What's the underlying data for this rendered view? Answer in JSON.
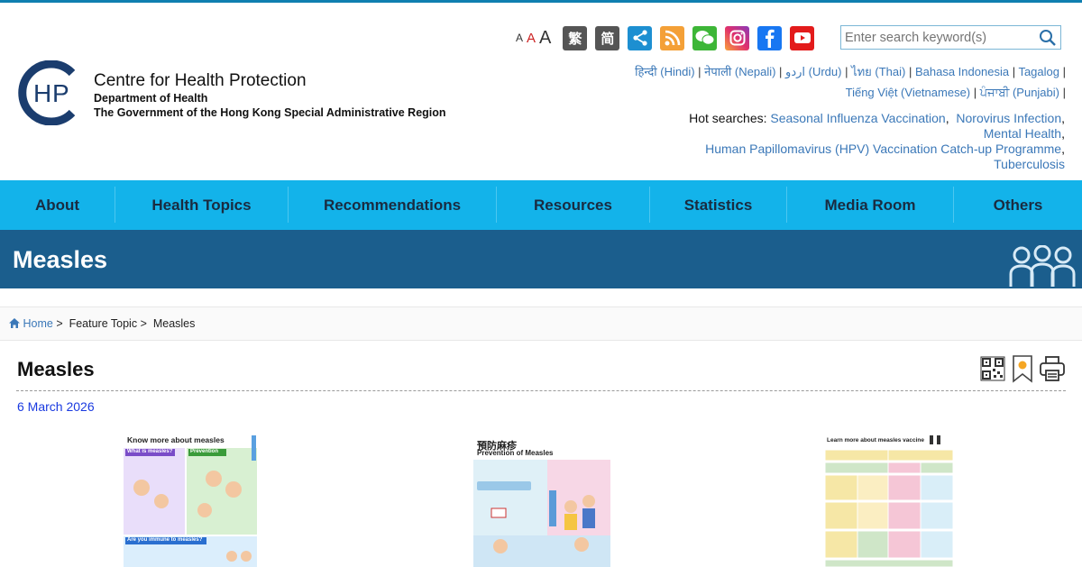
{
  "header": {
    "org_name": "Centre for Health Protection",
    "dept": "Department of Health",
    "gov": "The Government of the Hong Kong Special Administrative Region",
    "font_sizes": [
      "A",
      "A",
      "A"
    ],
    "trad_label": "繁",
    "simp_label": "简",
    "search": {
      "placeholder": "Enter search keyword(s)"
    },
    "languages_line1": [
      "हिन्दी (Hindi)",
      "नेपाली (Nepali)",
      "اردو (Urdu)",
      "ไทย (Thai)",
      "Bahasa Indonesia",
      "Tagalog"
    ],
    "languages_line2": [
      "Tiếng Việt (Vietnamese)",
      "ਪੰਜਾਬੀ (Punjabi)"
    ],
    "hot_label": "Hot searches:",
    "hot_items": [
      "Seasonal Influenza Vaccination",
      "Norovirus Infection",
      "Mental Health",
      "Human Papillomavirus (HPV) Vaccination Catch-up Programme",
      "Tuberculosis"
    ],
    "icons": [
      "share-icon",
      "rss-icon",
      "wechat-icon",
      "instagram-icon",
      "facebook-icon",
      "youtube-icon"
    ]
  },
  "nav": [
    "About",
    "Health Topics",
    "Recommendations",
    "Resources",
    "Statistics",
    "Media Room",
    "Others"
  ],
  "banner": {
    "title": "Measles"
  },
  "breadcrumb": {
    "home": "Home",
    "sep": ">",
    "feature": "Feature Topic",
    "current": "Measles"
  },
  "page": {
    "title": "Measles",
    "date": "6 March 2026"
  },
  "posters": [
    {
      "heading": "Know more about measles",
      "box1": "What is measles?",
      "box2": "Prevention",
      "box3": "Are you immune to measles?"
    },
    {
      "heading_zh": "預防麻疹",
      "heading_en": "Prevention of Measles"
    },
    {
      "heading": "Learn more about measles vaccine"
    }
  ],
  "colors": {
    "nav_bg": "#13b3ea",
    "banner_bg": "#1b5e8d",
    "link": "#3b78b8",
    "date": "#1a3ae0"
  }
}
